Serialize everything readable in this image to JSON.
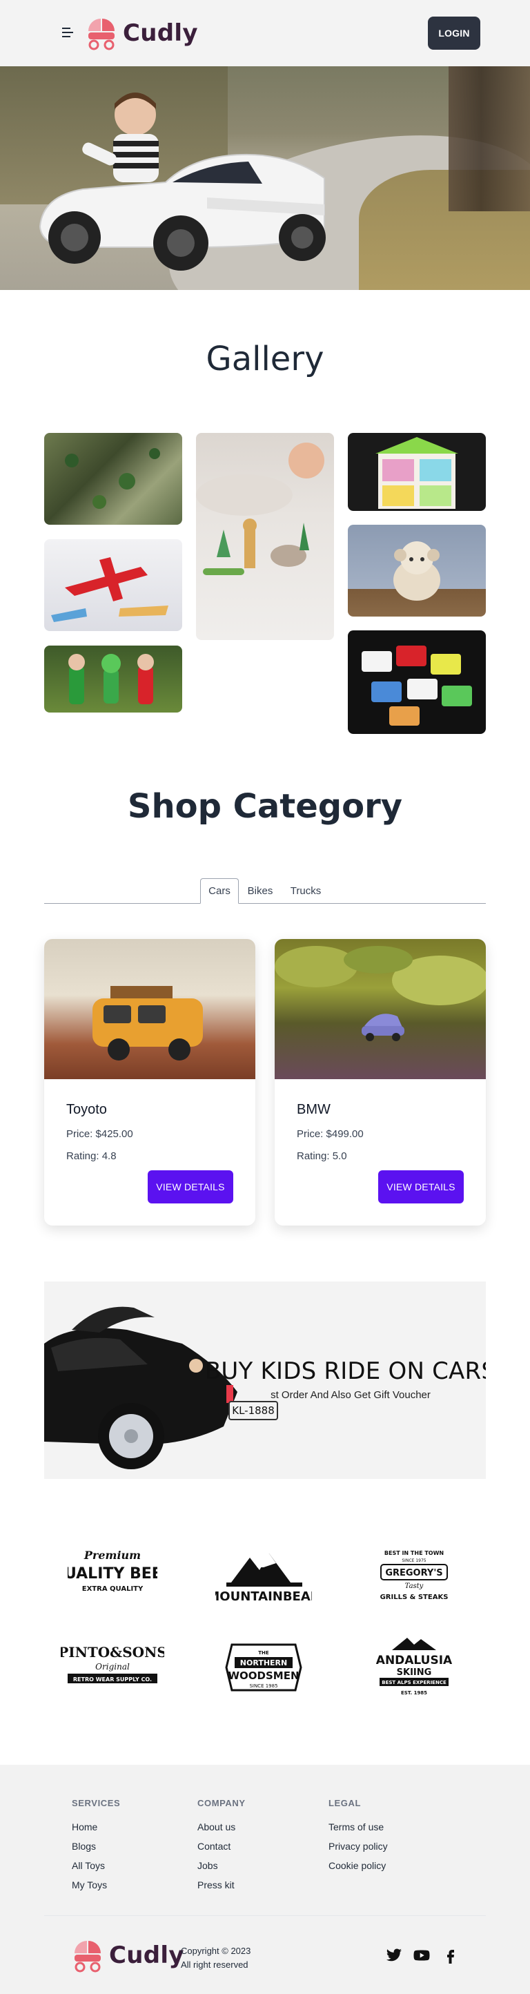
{
  "nav": {
    "brand": "Cudly",
    "login_label": "LOGIN"
  },
  "gallery": {
    "title": "Gallery"
  },
  "shop": {
    "title": "Shop Category",
    "tabs": [
      {
        "label": "Cars",
        "active": true
      },
      {
        "label": "Bikes",
        "active": false
      },
      {
        "label": "Trucks",
        "active": false
      }
    ],
    "products": [
      {
        "name": "Toyoto",
        "price": "Price: $425.00",
        "rating": "Rating: 4.8",
        "button": "VIEW DETAILS"
      },
      {
        "name": "BMW",
        "price": "Price: $499.00",
        "rating": "Rating: 5.0",
        "button": "VIEW DETAILS"
      }
    ]
  },
  "promo": {
    "title": "BUY KIDS RIDE ON CARS",
    "subtitle": "st Order And Also Get Gift Voucher",
    "plate": "KL-1888"
  },
  "brands": [
    {
      "lines": [
        "Premium",
        "QUALITY BEER",
        "EXTRA QUALITY"
      ]
    },
    {
      "lines": [
        "MOUNTAINBEAR"
      ]
    },
    {
      "lines": [
        "BEST IN THE TOWN",
        "SINCE 1975",
        "GREGORY'S",
        "Tasty",
        "GRILLS & STEAKS"
      ]
    },
    {
      "lines": [
        "PINTO&SONS",
        "Original",
        "RETRO WEAR SUPPLY CO."
      ]
    },
    {
      "lines": [
        "THE",
        "NORTHERN",
        "WOODSMEN",
        "SINCE 1985"
      ]
    },
    {
      "lines": [
        "ANDALUSIA",
        "SKIING",
        "BEST ALPS EXPERIENCE",
        "EST. 1985"
      ]
    }
  ],
  "footer": {
    "services": {
      "heading": "SERVICES",
      "links": [
        "Home",
        "Blogs",
        "All Toys",
        "My Toys"
      ]
    },
    "company": {
      "heading": "COMPANY",
      "links": [
        "About us",
        "Contact",
        "Jobs",
        "Press kit"
      ]
    },
    "legal": {
      "heading": "LEGAL",
      "links": [
        "Terms of use",
        "Privacy policy",
        "Cookie policy"
      ]
    },
    "brand": "Cudly",
    "copyright_line1": "Copyright © 2023",
    "copyright_line2": "All right reserved"
  },
  "colors": {
    "accent": "#5b12f0",
    "login_bg": "#2d3340",
    "brand_text": "#3b1f3b",
    "logo_pink": "#e8606e"
  },
  "icons": [
    "menu-icon",
    "stroller-icon",
    "twitter-icon",
    "youtube-icon",
    "facebook-icon"
  ]
}
